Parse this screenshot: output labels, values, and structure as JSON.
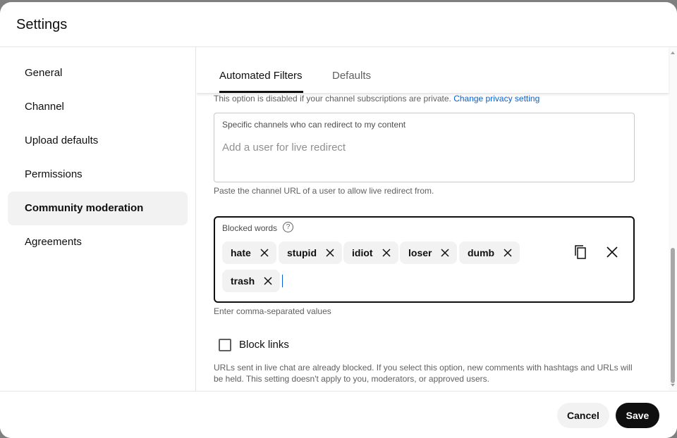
{
  "dialog": {
    "title": "Settings"
  },
  "sidebar": {
    "items": [
      {
        "label": "General",
        "active": false
      },
      {
        "label": "Channel",
        "active": false
      },
      {
        "label": "Upload defaults",
        "active": false
      },
      {
        "label": "Permissions",
        "active": false
      },
      {
        "label": "Community moderation",
        "active": true
      },
      {
        "label": "Agreements",
        "active": false
      }
    ]
  },
  "tabs": [
    {
      "label": "Automated Filters",
      "active": true
    },
    {
      "label": "Defaults",
      "active": false
    }
  ],
  "privacy_note": {
    "text": "This option is disabled if your channel subscriptions are private.",
    "link": "Change privacy setting"
  },
  "live_redirect": {
    "label": "Specific channels who can redirect to my content",
    "placeholder": "Add a user for live redirect",
    "value": "",
    "helper": "Paste the channel URL of a user to allow live redirect from."
  },
  "blocked_words": {
    "label": "Blocked words",
    "help_icon": "?",
    "chips": [
      "hate",
      "stupid",
      "idiot",
      "loser",
      "dumb",
      "trash"
    ],
    "helper": "Enter comma-separated values",
    "copy_icon": "copy-icon",
    "clear_icon": "clear-icon"
  },
  "block_links": {
    "label": "Block links",
    "checked": false,
    "description": "URLs sent in live chat are already blocked. If you select this option, new comments with hashtags and URLs will be held. This setting doesn't apply to you, moderators, or approved users."
  },
  "footer": {
    "cancel": "Cancel",
    "save": "Save"
  }
}
